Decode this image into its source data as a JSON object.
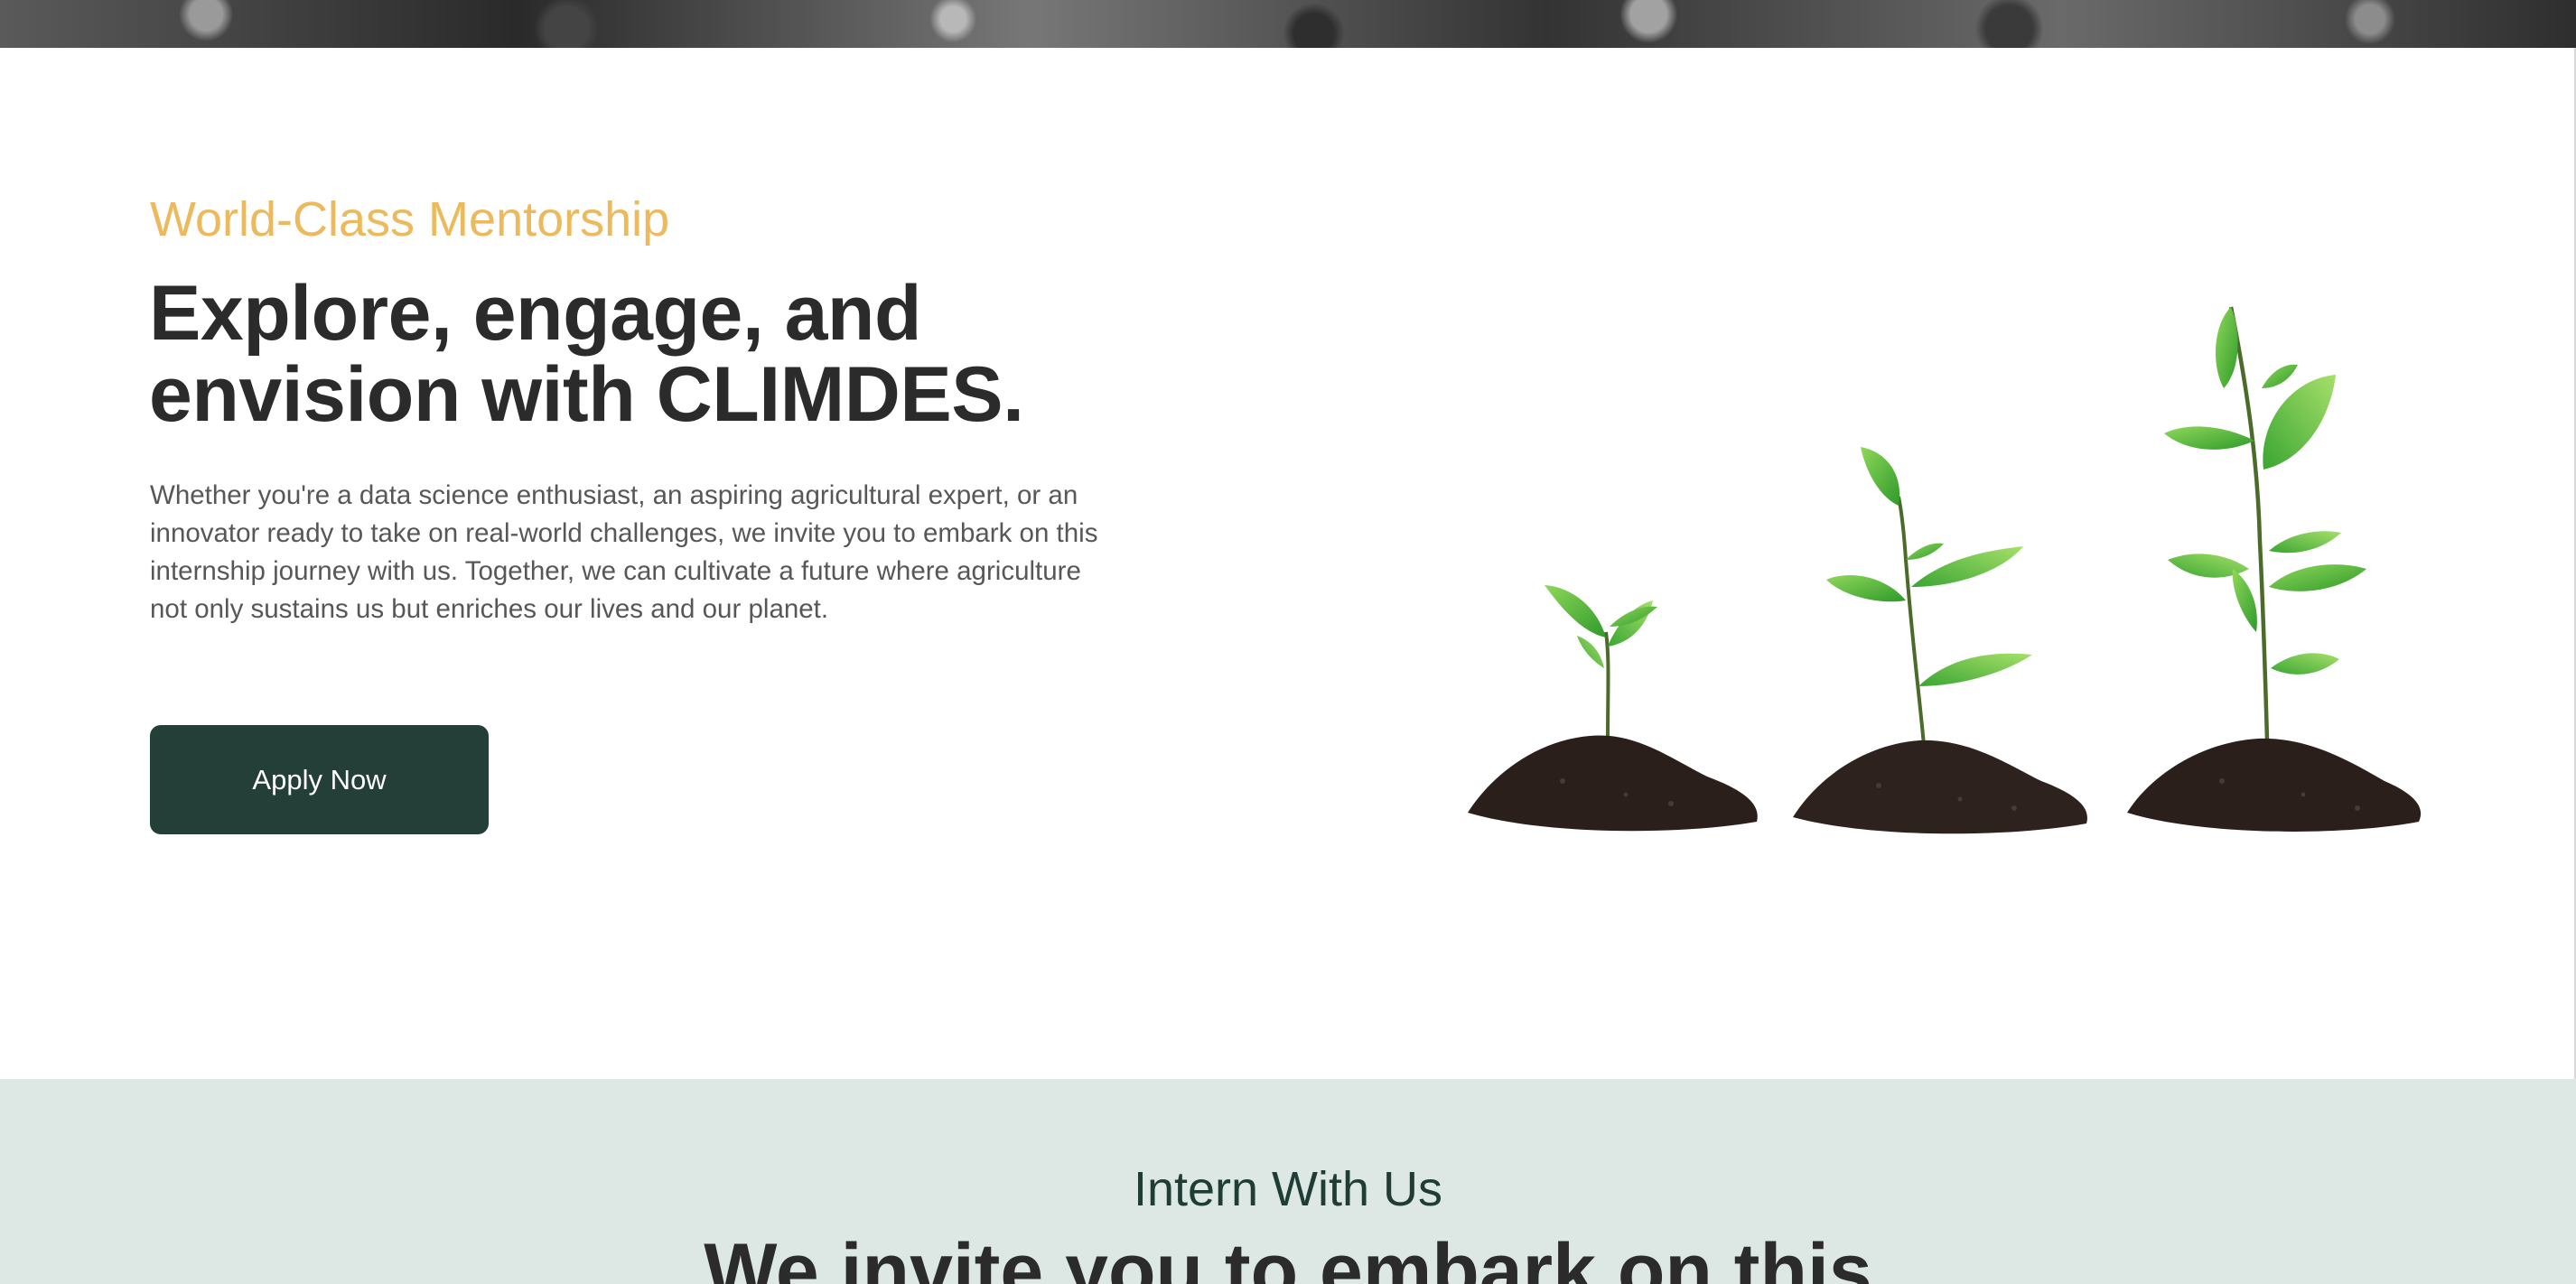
{
  "hero": {
    "eyebrow": "World-Class Mentorship",
    "headline_line1": "Explore, engage, and",
    "headline_line2": "envision with CLIMDES.",
    "intro": "Whether you're a data science enthusiast, an aspiring agricultural expert, or an innovator ready to take on real-world challenges, we invite you to embark on this internship journey with us. Together, we can cultivate a future where agriculture not only sustains us but enriches our lives and our planet.",
    "apply_label": "Apply Now",
    "image_icon": "growing-seedlings-icon"
  },
  "intern_section": {
    "kicker": "Intern With Us",
    "heading": "We invite you to embark on this"
  },
  "colors": {
    "accent": "#ecb95d",
    "button": "#233f38",
    "section_bg": "#dde8e5",
    "heading_text": "#2b2b2b"
  }
}
